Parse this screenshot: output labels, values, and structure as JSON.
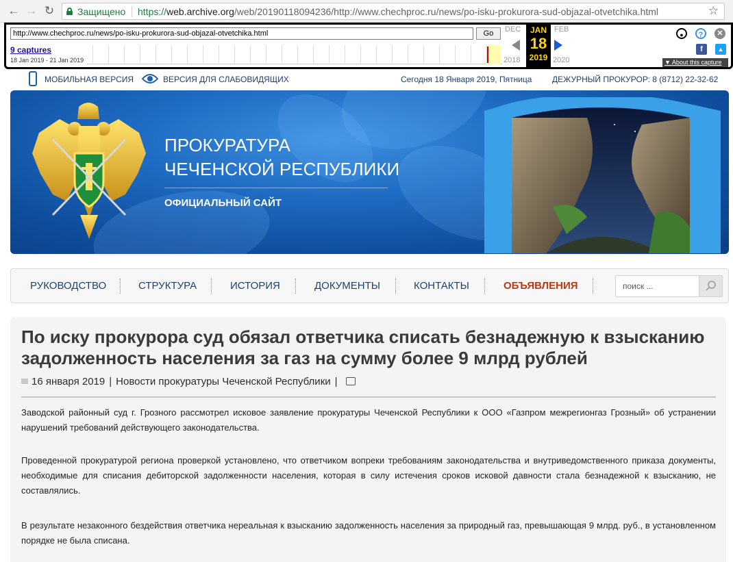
{
  "browser": {
    "secure_label": "Защищено",
    "url_scheme": "https://",
    "url_host": "web.archive.org",
    "url_path": "/web/20190118094236/http://www.chechproc.ru/news/po-isku-prokurora-sud-objazal-otvetchika.html"
  },
  "wayback": {
    "url_value": "http://www.chechproc.ru/news/po-isku-prokurora-sud-objazal-otvetchika.html",
    "go_label": "Go",
    "captures": "9 captures",
    "range": "18 Jan 2019 - 21 Jan 2019",
    "prev_month": "DEC",
    "prev_year": "2018",
    "cur_month": "JAN",
    "cur_day": "18",
    "cur_year": "2019",
    "next_month": "FEB",
    "next_year": "2020",
    "about_label": "About this capture"
  },
  "topbar": {
    "mobile": "МОБИЛЬНАЯ ВЕРСИЯ",
    "accessible": "ВЕРСИЯ ДЛЯ СЛАБОВИДЯЩИХ",
    "today": "Сегодня 18 Января 2019, Пятница",
    "duty": "ДЕЖУРНЫЙ ПРОКУРОР: 8 (8712) 22-32-62"
  },
  "banner": {
    "title_line1": "ПРОКУРАТУРА",
    "title_line2": "ЧЕЧЕНСКОЙ РЕСПУБЛИКИ",
    "subtitle": "ОФИЦИАЛЬНЫЙ САЙТ"
  },
  "menu": {
    "items": [
      "РУКОВОДСТВО",
      "СТРУКТУРА",
      "ИСТОРИЯ",
      "ДОКУМЕНТЫ",
      "КОНТАКТЫ",
      "ОБЪЯВЛЕНИЯ"
    ],
    "search_placeholder": "поиск ..."
  },
  "article": {
    "title": "По иску прокурора суд обязал ответчика списать безнадежную к взысканию задолженность населения за газ на сумму более 9 млрд рублей",
    "date": "16 января 2019",
    "category": "Новости прокуратуры Чеченской Республики",
    "paragraphs": [
      "Заводской районный суд г. Грозного рассмотрел исковое заявление прокуратуры Чеченской Республики к ООО «Газпром межрегионгаз Грозный» об устранении нарушений требований действующего законодательства.",
      "Проведенной прокуратурой региона проверкой установлено, что ответчиком вопреки требованиям законодательства и внутриведомственного приказа документы, необходимые для списания дебиторской задолженности населения, которая в силу истечения сроков исковой давности стала безнадежной к взысканию, не составлялись.",
      "В результате незаконного бездействия ответчика нереальная к взысканию задолженность населения за природный газ, превышающая 9 млрд. руб., в установленном порядке не была списана."
    ]
  },
  "colors": {
    "banner_blue": "#1f6cc4",
    "nav_text": "#1f3f6e",
    "announce_red": "#b43a18",
    "secure_green": "#188038"
  }
}
